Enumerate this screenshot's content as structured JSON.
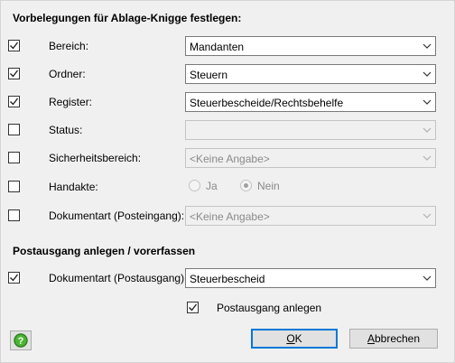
{
  "section1": {
    "title": "Vorbelegungen für Ablage-Knigge festlegen:"
  },
  "rows": [
    {
      "label": "Bereich:",
      "checked": true,
      "value": "Mandanten",
      "enabled": true
    },
    {
      "label": "Ordner:",
      "checked": true,
      "value": "Steuern",
      "enabled": true
    },
    {
      "label": "Register:",
      "checked": true,
      "value": "Steuerbescheide/Rechtsbehelfe",
      "enabled": true
    },
    {
      "label": "Status:",
      "checked": false,
      "value": "",
      "enabled": false
    },
    {
      "label": "Sicherheitsbereich:",
      "checked": false,
      "value": "<Keine Angabe>",
      "enabled": false
    },
    {
      "label": "Handakte:",
      "checked": false,
      "enabled": false
    },
    {
      "label": "Dokumentart (Posteingang):",
      "checked": false,
      "value": "<Keine Angabe>",
      "enabled": false
    }
  ],
  "handakte": {
    "option_ja": "Ja",
    "option_nein": "Nein",
    "selected": "Nein"
  },
  "section2": {
    "title": "Postausgang anlegen / vorerfassen"
  },
  "postausgang": {
    "label": "Dokumentart (Postausgang):",
    "checked": true,
    "value": "Steuerbescheid",
    "anlegen_label": "Postausgang anlegen",
    "anlegen_checked": true
  },
  "buttons": {
    "ok": "OK",
    "ok_mnemonic": "O",
    "ok_rest": "K",
    "cancel": "Abbrechen",
    "cancel_mnemonic": "A",
    "cancel_rest": "bbrechen"
  },
  "icons": {
    "help": "help-icon"
  },
  "colors": {
    "accent": "#0078d7",
    "help_green": "#3c9a29"
  }
}
